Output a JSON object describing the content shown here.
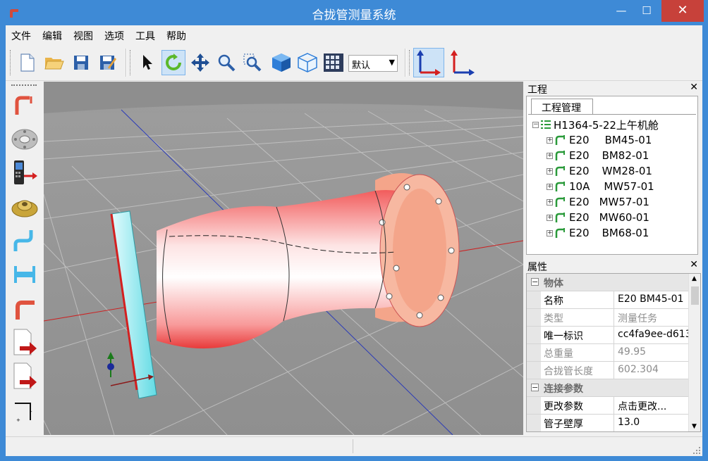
{
  "window": {
    "title": "合拢管测量系统",
    "min": "—",
    "max": "☐",
    "close": "✕"
  },
  "menu": [
    "文件",
    "编辑",
    "视图",
    "选项",
    "工具",
    "帮助"
  ],
  "toolbar": {
    "view_combo": "默认"
  },
  "project_panel": {
    "title": "工程",
    "close": "✕",
    "tab": "工程管理",
    "root": "H1364-5-22上午机舱",
    "items": [
      {
        "a": "E20",
        "b": "BM45-01"
      },
      {
        "a": "E20",
        "b": "BM82-01"
      },
      {
        "a": "E20",
        "b": "WM28-01"
      },
      {
        "a": "10A",
        "b": "MW57-01"
      },
      {
        "a": "E20",
        "b": "MW57-01"
      },
      {
        "a": "E20",
        "b": "MW60-01"
      },
      {
        "a": "E20",
        "b": "BM68-01"
      }
    ]
  },
  "props_panel": {
    "title": "属性",
    "close": "✕",
    "cat1": "物体",
    "rows1": [
      {
        "k": "名称",
        "v": "E20      BM45-01"
      },
      {
        "k": "类型",
        "v": "测量任务"
      },
      {
        "k": "唯一标识",
        "v": "cc4fa9ee-d613-"
      },
      {
        "k": "总重量",
        "v": "49.95"
      },
      {
        "k": "合拢管长度",
        "v": "602.304"
      }
    ],
    "cat2": "连接参数",
    "rows2": [
      {
        "k": "更改参数",
        "v": "点击更改..."
      },
      {
        "k": "管子壁厚",
        "v": "13.0"
      }
    ]
  }
}
